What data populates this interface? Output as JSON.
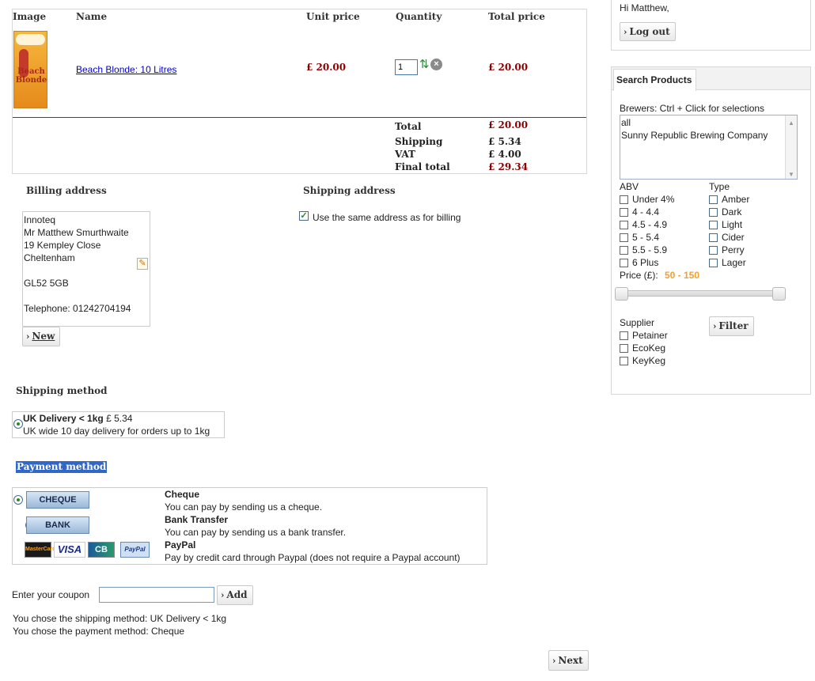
{
  "cart": {
    "headers": {
      "image": "Image",
      "name": "Name",
      "unit_price": "Unit price",
      "quantity": "Quantity",
      "total_price": "Total price"
    },
    "item": {
      "product_art_text": "Beach Blonde",
      "name": "Beach Blonde: 10 Litres",
      "unit_price": "£ 20.00",
      "quantity": "1",
      "total_price": "£ 20.00"
    },
    "totals": {
      "total_label": "Total",
      "total_value": "£ 20.00",
      "shipping_label": "Shipping",
      "shipping_value": "£ 5.34",
      "vat_label": "VAT",
      "vat_value": "£ 4.00",
      "final_label": "Final total",
      "final_value": "£ 29.34"
    }
  },
  "billing": {
    "title": "Billing address",
    "lines": [
      "Innoteq",
      "Mr Matthew Smurthwaite",
      "19 Kempley Close",
      "Cheltenham",
      "",
      "GL52 5GB",
      "",
      "Telephone: 01242704194"
    ],
    "new_button": "New"
  },
  "shipping_address": {
    "title": "Shipping address",
    "same_as_billing": "Use the same address as for billing",
    "same_checked": true
  },
  "shipping_method": {
    "title": "Shipping method",
    "option_name": "UK Delivery < 1kg",
    "option_price": "£ 5.34",
    "option_desc": "UK wide 10 day delivery for orders up to 1kg"
  },
  "payment_method": {
    "title": "Payment method",
    "options": [
      {
        "button": "CHEQUE",
        "name": "Cheque",
        "desc": "You can pay by sending us a cheque.",
        "selected": true
      },
      {
        "button": "BANK",
        "name": "Bank Transfer",
        "desc": "You can pay by sending us a bank transfer.",
        "selected": false
      },
      {
        "cards": [
          "MasterCard",
          "VISA",
          "CB",
          "PayPal"
        ],
        "name": "PayPal",
        "desc": "Pay by credit card through Paypal (does not require a Paypal account)",
        "selected": false
      }
    ]
  },
  "coupon": {
    "label": "Enter your coupon",
    "value": "",
    "add_button": "Add"
  },
  "summary": {
    "shipping_line": "You chose the shipping method: UK Delivery < 1kg",
    "payment_line": "You chose the payment method: Cheque"
  },
  "next_button": "Next",
  "user": {
    "greeting": "Hi Matthew,",
    "logout_button": "Log out"
  },
  "search": {
    "tab_label": "Search Products",
    "brewers_label": "Brewers: Ctrl + Click for selections",
    "brewers_options": [
      "all",
      "Sunny Republic Brewing Company"
    ],
    "abv_label": "ABV",
    "abv_options": [
      "Under 4%",
      "4 - 4.4",
      "4.5 - 4.9",
      "5 - 5.4",
      "5.5 - 5.9",
      "6 Plus"
    ],
    "type_label": "Type",
    "type_options": [
      "Amber",
      "Dark",
      "Light",
      "Cider",
      "Perry",
      "Lager"
    ],
    "price_label": "Price (£):",
    "price_range": "50 - 150",
    "supplier_label": "Supplier",
    "supplier_options": [
      "Petainer",
      "EcoKeg",
      "KeyKeg"
    ],
    "filter_button": "Filter"
  },
  "colors": {
    "accent_red": "#8b0000",
    "price_orange": "#f0a030",
    "payment_title_bg": "#3168c8"
  }
}
